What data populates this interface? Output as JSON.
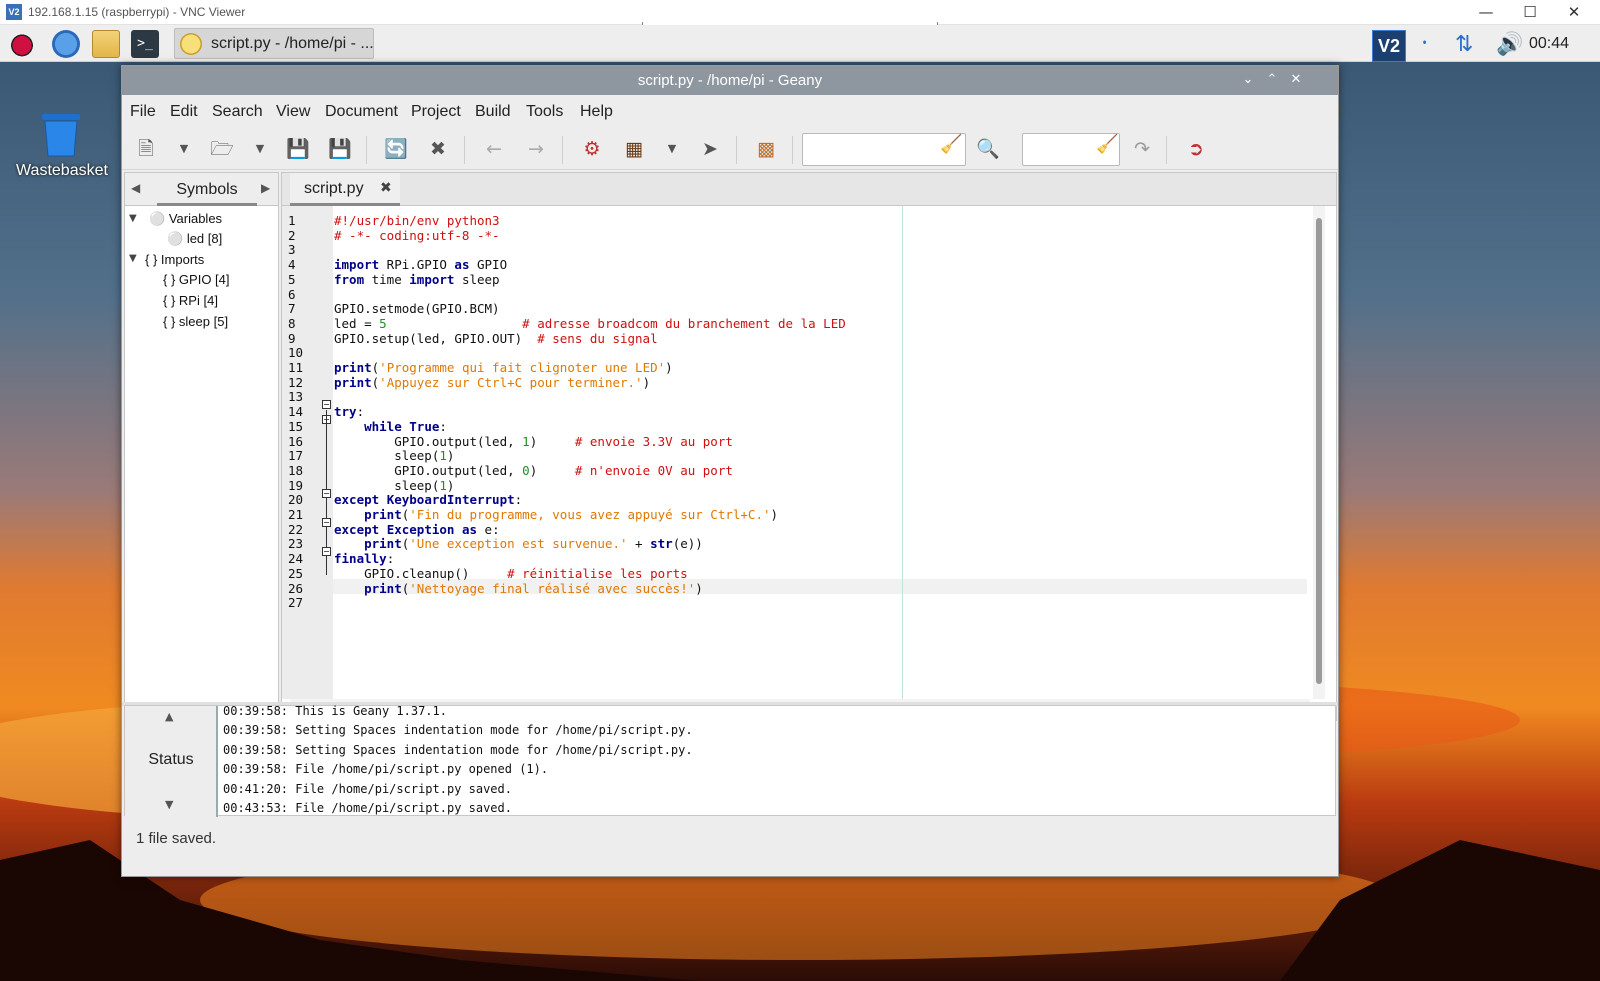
{
  "vnc": {
    "title": "192.168.1.15 (raspberrypi) - VNC Viewer",
    "logo": "V2"
  },
  "taskbar": {
    "task_label": "script.py - /home/pi - ...",
    "tray_vnc": "V2",
    "clock": "00:44",
    "icons": [
      "raspberry-menu-icon",
      "web-browser-icon",
      "file-manager-icon",
      "terminal-icon"
    ]
  },
  "desktop": {
    "trash_label": "Wastebasket"
  },
  "window": {
    "title": "script.py - /home/pi - Geany",
    "menu": [
      "File",
      "Edit",
      "Search",
      "View",
      "Document",
      "Project",
      "Build",
      "Tools",
      "Help"
    ],
    "search_value": "",
    "goto_value": ""
  },
  "sidebar": {
    "tab": "Symbols",
    "groups": [
      {
        "label": "Variables",
        "items": [
          "led [8]"
        ]
      },
      {
        "label": "Imports",
        "items": [
          "GPIO [4]",
          "RPi [4]",
          "sleep [5]"
        ]
      }
    ]
  },
  "editor": {
    "tab": "script.py",
    "line_numbers": [
      "1",
      "2",
      "3",
      "4",
      "5",
      "6",
      "7",
      "8",
      "9",
      "10",
      "11",
      "12",
      "13",
      "14",
      "15",
      "16",
      "17",
      "18",
      "19",
      "20",
      "21",
      "22",
      "23",
      "24",
      "25",
      "26",
      "27"
    ],
    "lines": [
      "#!/usr/bin/env python3",
      "# -*- coding:utf-8 -*-",
      "",
      "import RPi.GPIO as GPIO",
      "from time import sleep",
      "",
      "GPIO.setmode(GPIO.BCM)",
      "led = 5                  # adresse broadcom du branchement de la LED",
      "GPIO.setup(led, GPIO.OUT)  # sens du signal",
      "",
      "print('Programme qui fait clignoter une LED')",
      "print('Appuyez sur Ctrl+C pour terminer.')",
      "",
      "try:",
      "    while True:",
      "        GPIO.output(led, 1)     # envoie 3.3V au port",
      "        sleep(1)",
      "        GPIO.output(led, 0)     # n'envoie 0V au port",
      "        sleep(1)",
      "except KeyboardInterrupt:",
      "    print('Fin du programme, vous avez appuyé sur Ctrl+C.')",
      "except Exception as e:",
      "    print('Une exception est survenue.' + str(e))",
      "finally:",
      "    GPIO.cleanup()     # réinitialise les ports",
      "    print('Nettoyage final réalisé avec succès!')",
      ""
    ]
  },
  "messages": {
    "tab": "Status",
    "lines": [
      "00:39:58: This is Geany 1.37.1.",
      "00:39:58: Setting Spaces indentation mode for /home/pi/script.py.",
      "00:39:58: Setting Spaces indentation mode for /home/pi/script.py.",
      "00:39:58: File /home/pi/script.py opened (1).",
      "00:41:20: File /home/pi/script.py saved.",
      "00:43:53: File /home/pi/script.py saved."
    ]
  },
  "statusbar": {
    "text": "1 file saved."
  },
  "colors": {
    "keyword": "#000088",
    "comment": "#d01010",
    "string": "#e07800",
    "number": "#209020",
    "titlebar": "#8e97a0"
  }
}
